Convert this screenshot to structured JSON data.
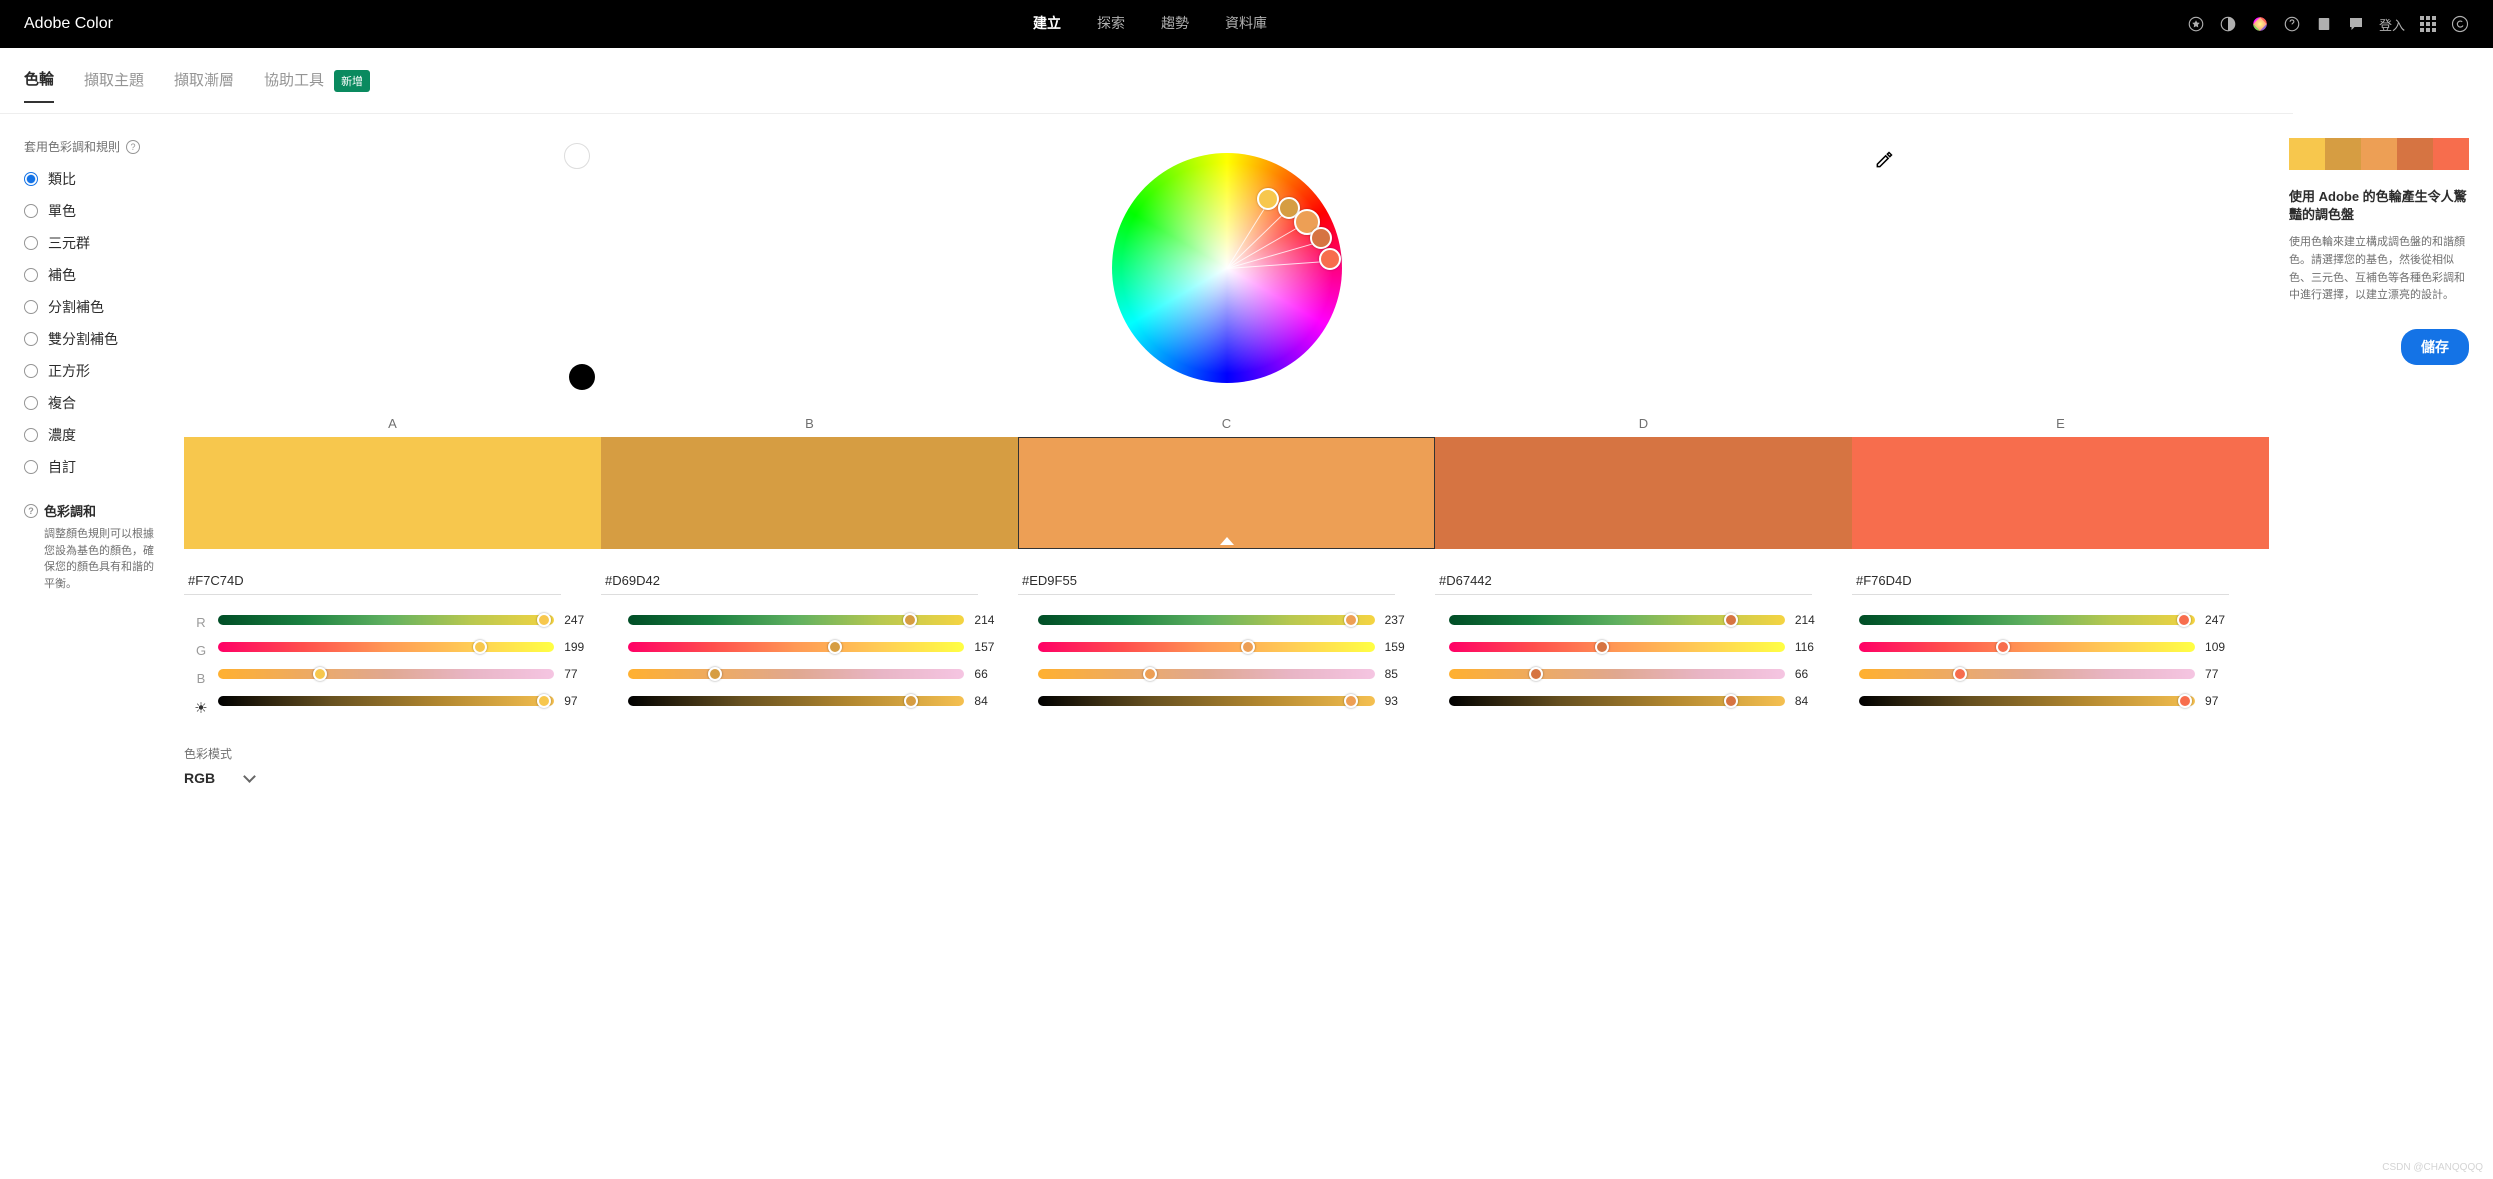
{
  "header": {
    "logo": "Adobe Color",
    "nav": [
      "建立",
      "探索",
      "趨勢",
      "資料庫"
    ],
    "active_nav": 0,
    "login": "登入"
  },
  "subnav": {
    "tabs": [
      "色輪",
      "擷取主題",
      "擷取漸層",
      "協助工具"
    ],
    "active": 0,
    "new_badge": "新增"
  },
  "rules": {
    "title": "套用色彩調和規則",
    "items": [
      "類比",
      "單色",
      "三元群",
      "補色",
      "分割補色",
      "雙分割補色",
      "正方形",
      "複合",
      "濃度",
      "自訂"
    ],
    "selected": 0
  },
  "harmony": {
    "title": "色彩調和",
    "desc": "調整顏色規則可以根據您設為基色的顏色，確保您的顏色具有和諧的平衡。"
  },
  "swatch_labels": [
    "A",
    "B",
    "C",
    "D",
    "E"
  ],
  "colors": [
    {
      "hex": "#F7C74D",
      "r": 247,
      "g": 199,
      "b": 77,
      "l": 97
    },
    {
      "hex": "#D69D42",
      "r": 214,
      "g": 157,
      "b": 66,
      "l": 84
    },
    {
      "hex": "#ED9F55",
      "r": 237,
      "g": 159,
      "b": 85,
      "l": 93
    },
    {
      "hex": "#D67442",
      "r": 214,
      "g": 116,
      "b": 66,
      "l": 84
    },
    {
      "hex": "#F76D4D",
      "r": 247,
      "g": 109,
      "b": 77,
      "l": 97
    }
  ],
  "base_index": 2,
  "channels": [
    "R",
    "G",
    "B"
  ],
  "mode": {
    "label": "色彩模式",
    "value": "RGB"
  },
  "right_panel": {
    "title": "使用 Adobe 的色輪產生令人驚豔的調色盤",
    "desc": "使用色輪來建立構成調色盤的和諧顏色。請選擇您的基色，然後從相似色、三元色、互補色等各種色彩調和中進行選擇，以建立漂亮的設計。",
    "save": "儲存"
  },
  "watermark": "CSDN @CHANQQQQ"
}
